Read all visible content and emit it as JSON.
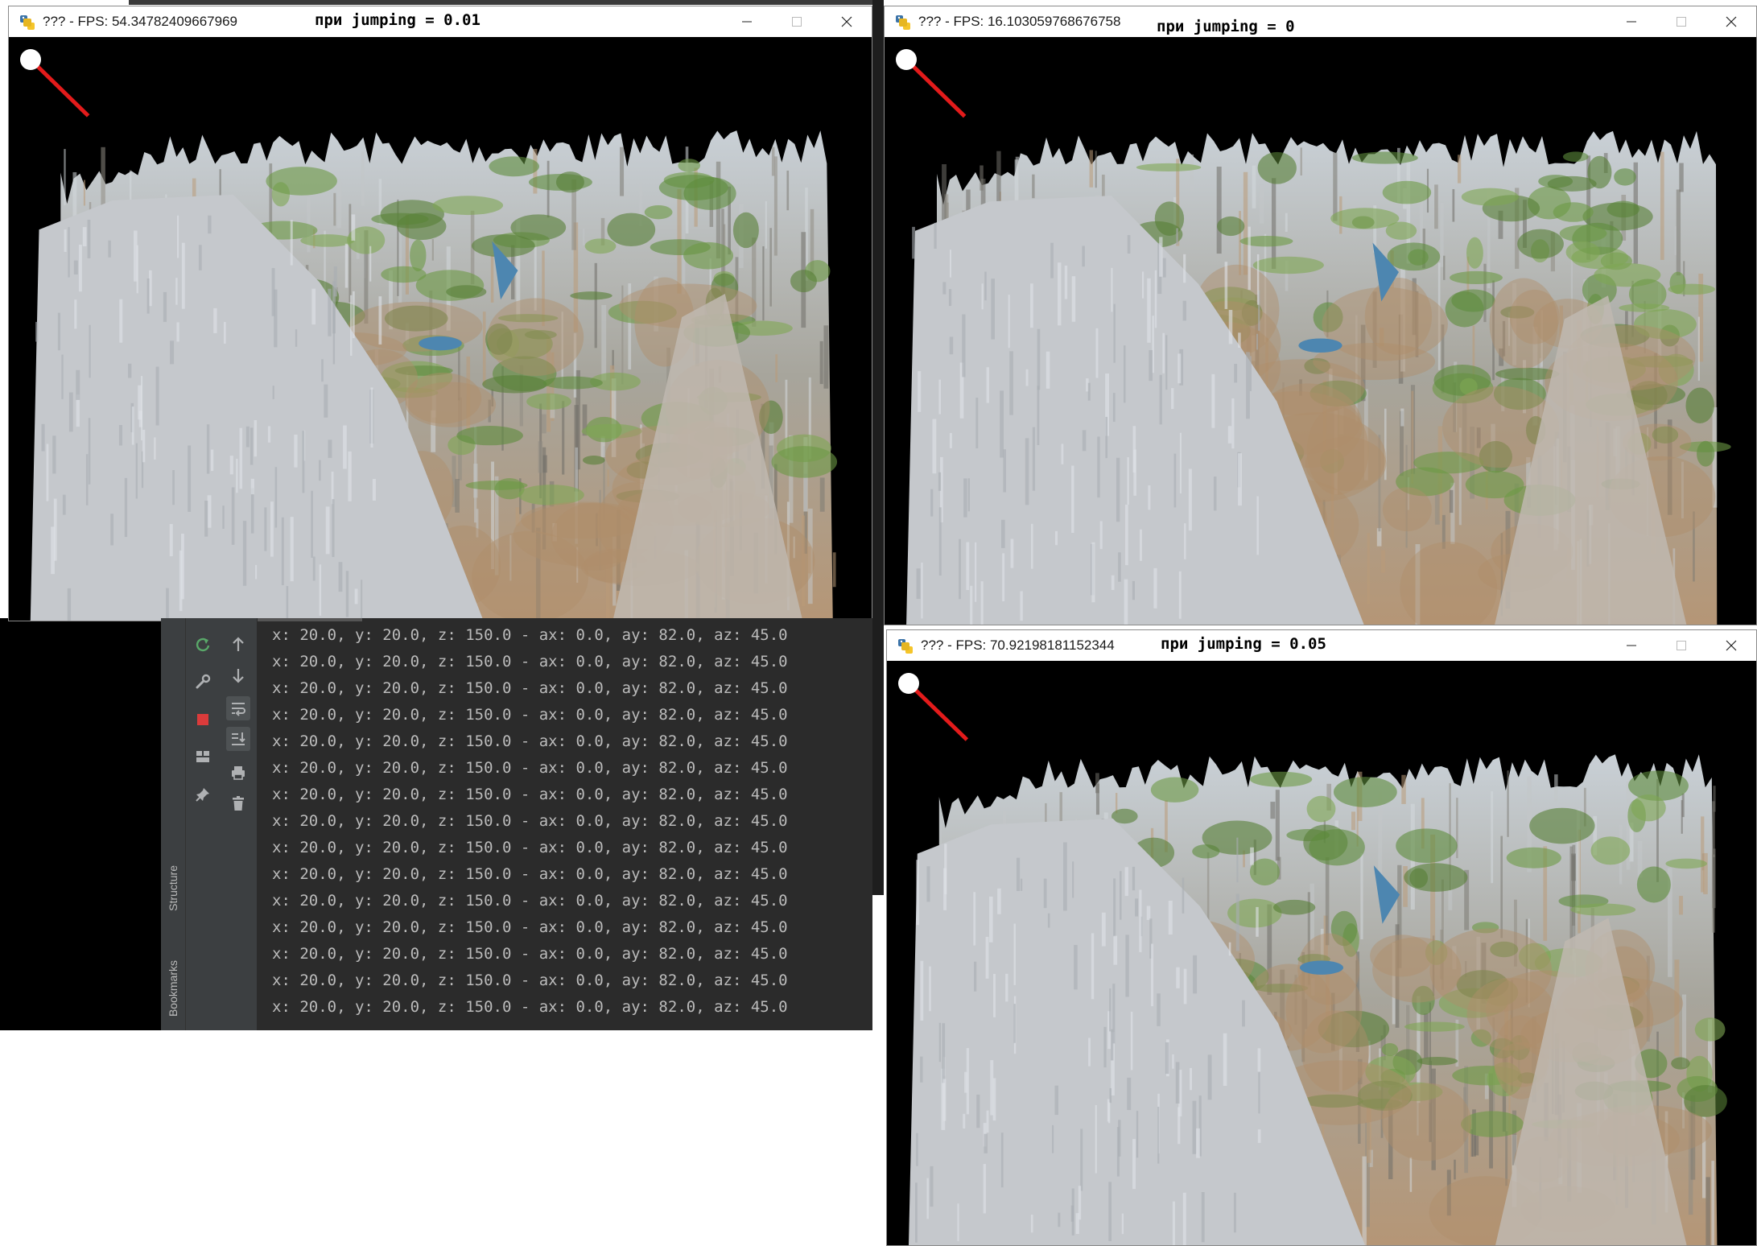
{
  "windows": [
    {
      "title": "??? - FPS: 54.34782409667969",
      "caption": "при jumping = 0.01"
    },
    {
      "title": "??? - FPS: 16.103059768676758",
      "caption": "при jumping = 0"
    },
    {
      "title": "??? - FPS: 70.92198181152344",
      "caption": "при jumping = 0.05"
    }
  ],
  "ide": {
    "side_tabs": [
      "Structure",
      "Bookmarks"
    ],
    "console_lines": [
      "x: 20.0, y: 20.0, z: 150.0 - ax: 0.0, ay: 82.0, az: 45.0",
      "x: 20.0, y: 20.0, z: 150.0 - ax: 0.0, ay: 82.0, az: 45.0",
      "x: 20.0, y: 20.0, z: 150.0 - ax: 0.0, ay: 82.0, az: 45.0",
      "x: 20.0, y: 20.0, z: 150.0 - ax: 0.0, ay: 82.0, az: 45.0",
      "x: 20.0, y: 20.0, z: 150.0 - ax: 0.0, ay: 82.0, az: 45.0",
      "x: 20.0, y: 20.0, z: 150.0 - ax: 0.0, ay: 82.0, az: 45.0",
      "x: 20.0, y: 20.0, z: 150.0 - ax: 0.0, ay: 82.0, az: 45.0",
      "x: 20.0, y: 20.0, z: 150.0 - ax: 0.0, ay: 82.0, az: 45.0",
      "x: 20.0, y: 20.0, z: 150.0 - ax: 0.0, ay: 82.0, az: 45.0",
      "x: 20.0, y: 20.0, z: 150.0 - ax: 0.0, ay: 82.0, az: 45.0",
      "x: 20.0, y: 20.0, z: 150.0 - ax: 0.0, ay: 82.0, az: 45.0",
      "x: 20.0, y: 20.0, z: 150.0 - ax: 0.0, ay: 82.0, az: 45.0",
      "x: 20.0, y: 20.0, z: 150.0 - ax: 0.0, ay: 82.0, az: 45.0",
      "x: 20.0, y: 20.0, z: 150.0 - ax: 0.0, ay: 82.0, az: 45.0",
      "x: 20.0, y: 20.0, z: 150.0 - ax: 0.0, ay: 82.0, az: 45.0"
    ]
  },
  "colors": {
    "compass_line": "#e31b1b",
    "compass_dot": "#ffffff",
    "console_bg": "#2b2b2b",
    "console_text": "#bbbbbb",
    "ide_panel": "#3c3f41",
    "rerun_icon": "#59a869",
    "stop_icon": "#db3b3b"
  }
}
